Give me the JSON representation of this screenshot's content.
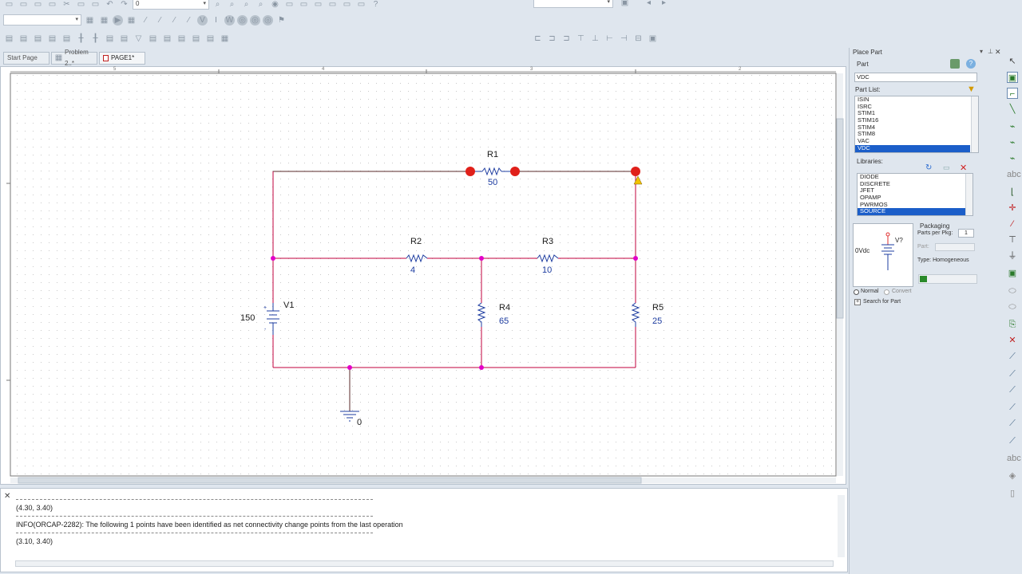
{
  "toolbar": {
    "zoom_value": "0",
    "part_search_value": ""
  },
  "tabs": [
    {
      "label": "Start Page"
    },
    {
      "label": "Problem 2..*"
    },
    {
      "label": "PAGE1*"
    }
  ],
  "ruler": {
    "top_marks": [
      "5",
      "4",
      "3",
      "2"
    ]
  },
  "schematic": {
    "parts": [
      {
        "ref": "R1",
        "value": "50"
      },
      {
        "ref": "R2",
        "value": "4"
      },
      {
        "ref": "R3",
        "value": "10"
      },
      {
        "ref": "R4",
        "value": "65"
      },
      {
        "ref": "R5",
        "value": "25"
      },
      {
        "ref": "V1",
        "value": "150"
      }
    ],
    "ground_label": "0",
    "battery_plus": "+",
    "battery_minus": "-"
  },
  "output": {
    "lines": [
      "(4.30, 3.40)",
      "INFO(ORCAP-2282): The following 1 points have been identified as net connectivity change points from the last operation",
      "(3.10, 3.40)"
    ]
  },
  "place_part": {
    "title": "Place Part",
    "part_label": "Part",
    "part_value": "VDC",
    "part_list_label": "Part List:",
    "part_list": [
      "ISIN",
      "ISRC",
      "STIM1",
      "STIM16",
      "STIM4",
      "STIM8",
      "VAC",
      "VDC"
    ],
    "part_list_selected": "VDC",
    "libraries_label": "Libraries:",
    "libraries": [
      "DIODE",
      "DISCRETE",
      "JFET",
      "OPAMP",
      "PWRMOS",
      "SOURCE"
    ],
    "libraries_selected": "SOURCE",
    "preview_value": "0Vdc",
    "preview_ref": "V?",
    "packaging_label": "Packaging",
    "parts_per_pkg_label": "Parts per Pkg:",
    "parts_per_pkg_value": "1",
    "part_field_label": "Part:",
    "type_label": "Type: Homogeneous",
    "normal_label": "Normal",
    "convert_label": "Convert",
    "search_label": "Search for Part"
  },
  "colors": {
    "wire_red": "#c0003c",
    "wire_dark": "#5a2a2a",
    "junction": "#e200c8",
    "selected_pin": "#e0201a",
    "value_blue": "#1d3ca0"
  }
}
